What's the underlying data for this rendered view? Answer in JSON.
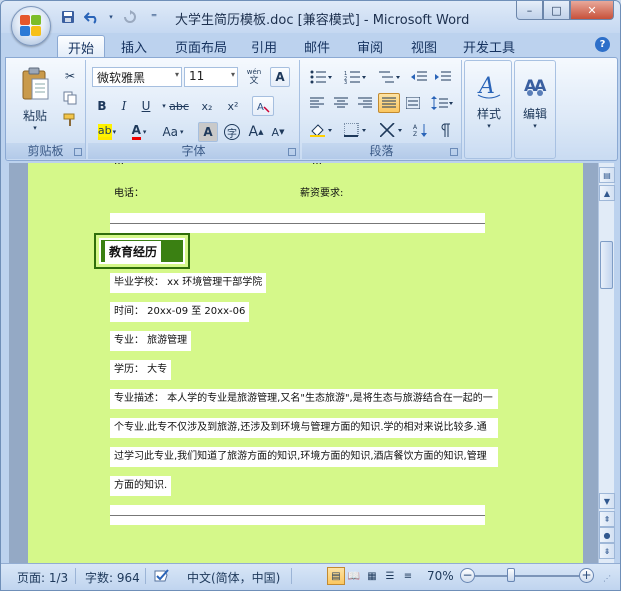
{
  "window": {
    "title": "大学生简历模板.doc [兼容模式] - Microsoft Word",
    "controls": {
      "minimize": "–",
      "maximize": "□",
      "close": "✕"
    }
  },
  "quick_access": {
    "save_icon": "save-icon",
    "undo_icon": "undo-icon",
    "redo_icon": "redo-icon",
    "customize": "⁼"
  },
  "tabs": [
    "开始",
    "插入",
    "页面布局",
    "引用",
    "邮件",
    "审阅",
    "视图",
    "开发工具"
  ],
  "active_tab": "开始",
  "ribbon": {
    "clipboard": {
      "label": "剪贴板",
      "paste": "粘贴"
    },
    "font": {
      "label": "字体",
      "font_name": "微软雅黑",
      "font_size": "11",
      "wen": "wén",
      "wen_char": "文",
      "A": "A",
      "bold": "B",
      "italic": "I",
      "underline": "U",
      "strike": "abc",
      "subscript": "x₂",
      "superscript": "x²",
      "aa": "Aa",
      "grow": "A",
      "shrink": "A",
      "char_border": "A",
      "char_shade": "A",
      "enclose": "字",
      "highlight": "ab",
      "font_color": "A"
    },
    "paragraph": {
      "label": "段落"
    },
    "styles": {
      "label": "样式"
    },
    "editing": {
      "label": "编辑"
    }
  },
  "document": {
    "top_partial_left": "…",
    "top_partial_right": "…",
    "phone_label": "电话：",
    "salary_label": "薪资要求:",
    "section_title": "教育经历",
    "school": "毕业学校： xx 环境管理干部学院",
    "time": "时间： 20xx-09 至 20xx-06",
    "major": "专业： 旅游管理",
    "degree": "学历： 大专",
    "desc_1": "专业描述： 本人学的专业是旅游管理,又名\"生态旅游\",是将生态与旅游结合在一起的一",
    "desc_2": "个专业.此专不仅涉及到旅游,还涉及到环境与管理方面的知识.学的相对来说比较多.通",
    "desc_3": "过学习此专业,我们知道了旅游方面的知识,环境方面的知识,酒店餐饮方面的知识,管理",
    "desc_4": "方面的知识."
  },
  "statusbar": {
    "page": "页面: 1/3",
    "words": "字数: 964",
    "language": "中文(简体，中国)",
    "zoom": "70%"
  }
}
